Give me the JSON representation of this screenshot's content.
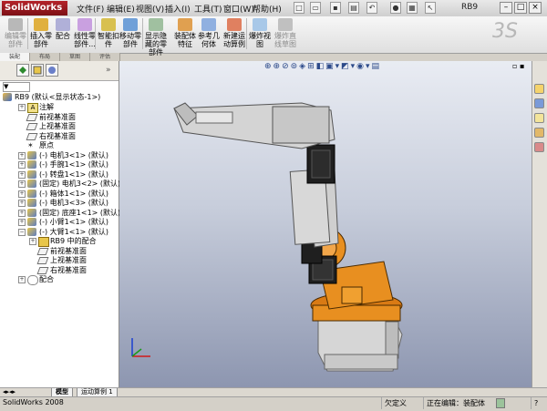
{
  "app": {
    "logo_text": "SolidWorks",
    "doc_title": "RB9",
    "status_app": "SolidWorks 2008",
    "status_under": "欠定义",
    "status_editing": "正在编辑：装配体",
    "status_help": "?"
  },
  "menu": [
    "文件(F)",
    "编辑(E)",
    "视图(V)",
    "插入(I)",
    "工具(T)",
    "窗口(W)",
    "帮助(H)"
  ],
  "ribbon": {
    "buttons": [
      {
        "label": "编辑零部件",
        "disabled": true
      },
      {
        "label": "插入零部件",
        "disabled": false
      },
      {
        "label": "配合",
        "disabled": false
      },
      {
        "label": "线性零部件...",
        "disabled": false
      },
      {
        "label": "智能扣件",
        "disabled": false
      },
      {
        "label": "移动零部件",
        "disabled": false
      },
      {
        "label": "显示隐藏的零部件",
        "disabled": false
      },
      {
        "label": "装配体特征",
        "disabled": false
      },
      {
        "label": "参考几何体",
        "disabled": false
      },
      {
        "label": "新建运动算例",
        "disabled": false
      },
      {
        "label": "爆炸视图",
        "disabled": false
      },
      {
        "label": "爆炸直线草图",
        "disabled": true
      }
    ]
  },
  "cm_tabs": [
    "装配",
    "布局",
    "草图",
    "评估"
  ],
  "tree": {
    "filter_placeholder": "▼",
    "root": "RB9 (默认<显示状态-1>)",
    "items": [
      {
        "label": "注解",
        "icon": "annotation-icon",
        "expander": "+"
      },
      {
        "label": "前视基准面",
        "icon": "plane-icon",
        "expander": ""
      },
      {
        "label": "上视基准面",
        "icon": "plane-icon",
        "expander": ""
      },
      {
        "label": "右视基准面",
        "icon": "plane-icon",
        "expander": ""
      },
      {
        "label": "原点",
        "icon": "origin-icon",
        "expander": ""
      },
      {
        "label": "(-) 电机3<1> (默认)",
        "icon": "part-icon",
        "expander": "+"
      },
      {
        "label": "(-) 手腕1<1> (默认)",
        "icon": "part-icon",
        "expander": "+"
      },
      {
        "label": "(-) 转盘1<1> (默认)",
        "icon": "part-icon",
        "expander": "+"
      },
      {
        "label": "(固定) 电机3<2> (默认)",
        "icon": "part-icon",
        "expander": "+"
      },
      {
        "label": "(-) 箱体1<1> (默认)",
        "icon": "part-icon",
        "expander": "+"
      },
      {
        "label": "(-) 电机3<3> (默认)",
        "icon": "part-icon",
        "expander": "+"
      },
      {
        "label": "(固定) 底座1<1> (默认)",
        "icon": "part-icon",
        "expander": "+"
      },
      {
        "label": "(-) 小臂1<1> (默认)",
        "icon": "part-icon",
        "expander": "+"
      },
      {
        "label": "(-) 大臂1<1> (默认)",
        "icon": "part-icon",
        "expander": "−"
      },
      {
        "label": "RB9 中的配合",
        "icon": "mates-folder-icon",
        "expander": "+",
        "indent": 1
      },
      {
        "label": "前视基准面",
        "icon": "plane-icon",
        "expander": "",
        "indent": 1
      },
      {
        "label": "上视基准面",
        "icon": "plane-icon",
        "expander": "",
        "indent": 1
      },
      {
        "label": "右视基准面",
        "icon": "plane-icon",
        "expander": "",
        "indent": 1
      },
      {
        "label": "配合",
        "icon": "mate-icon",
        "expander": "+"
      }
    ]
  },
  "bottom_tabs": [
    {
      "label": "模型",
      "active": true
    },
    {
      "label": "运动算例 1",
      "active": false
    }
  ],
  "colors": {
    "robot_grey": "#c9c9c9",
    "robot_orange": "#e88f20",
    "motor_black": "#1f1f1f"
  }
}
